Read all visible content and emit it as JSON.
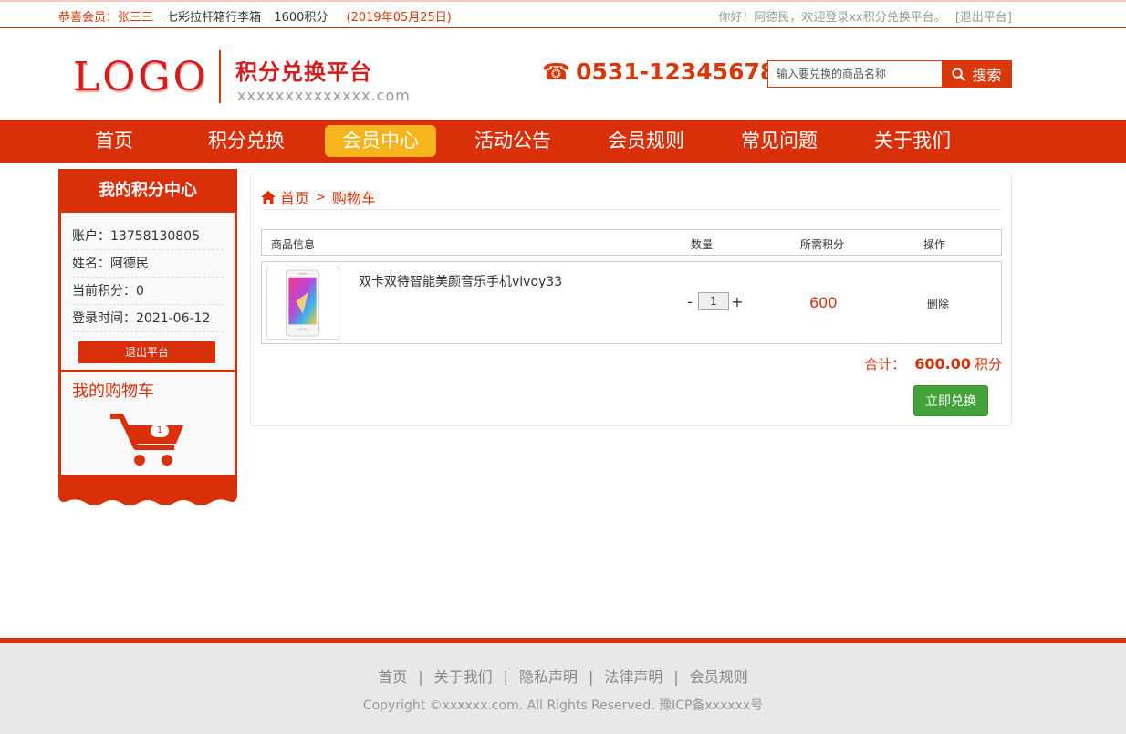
{
  "topbar": {
    "welcome": "恭喜会员：张三三",
    "gift": "七彩拉杆箱行李箱",
    "points": "1600积分",
    "date": "(2019年05月25日)",
    "greeting": "你好！阿德民，欢迎登录xx积分兑换平台。",
    "logout_link": "[退出平台]"
  },
  "header": {
    "logo": "LOGO",
    "platform_name": "积分兑换平台",
    "platform_url": "xxxxxxxxxxxxxx.com",
    "phone": "0531-12345678",
    "search_placeholder": "输入要兑换的商品名称",
    "search_button": "搜索"
  },
  "nav": {
    "items": [
      "首页",
      "积分兑换",
      "会员中心",
      "活动公告",
      "会员规则",
      "常见问题",
      "关于我们"
    ],
    "active": "会员中心"
  },
  "sidebar": {
    "title": "我的积分中心",
    "account": "账户：13758130805",
    "name": "姓名：阿德民",
    "current_points": "当前积分：0",
    "login_time": "登录时间：2021-06-12",
    "logout_button": "退出平台",
    "cart_title": "我的购物车",
    "cart_count": "1"
  },
  "main": {
    "breadcrumb_home": "首页",
    "breadcrumb_sep": ">",
    "breadcrumb_current": "购物车",
    "columns": [
      "商品信息",
      "数量",
      "所需积分",
      "操作"
    ],
    "items": [
      {
        "name": "双卡双待智能美颜音乐手机vivoy33",
        "quantity": "1",
        "minus": "-",
        "plus": "+",
        "points": "600",
        "action": "删除"
      }
    ],
    "total_label": "合计：",
    "total_value": "600.00",
    "total_unit": "积分",
    "submit_button": "立即兑换"
  },
  "footer": {
    "links": [
      "首页",
      "关于我们",
      "隐私声明",
      "法律声明",
      "会员规则"
    ],
    "separator": "|",
    "copyright": "Copyright ©xxxxxx.com. All Rights Reserved. 豫ICP备xxxxxx号"
  },
  "colors": {
    "brand_red": "#d9300a",
    "nav_active": "#f7b51d",
    "button_green": "#44a23a"
  },
  "icons": [
    "phone-icon",
    "search-icon",
    "home-icon",
    "cart-icon",
    "product-phone-image"
  ]
}
